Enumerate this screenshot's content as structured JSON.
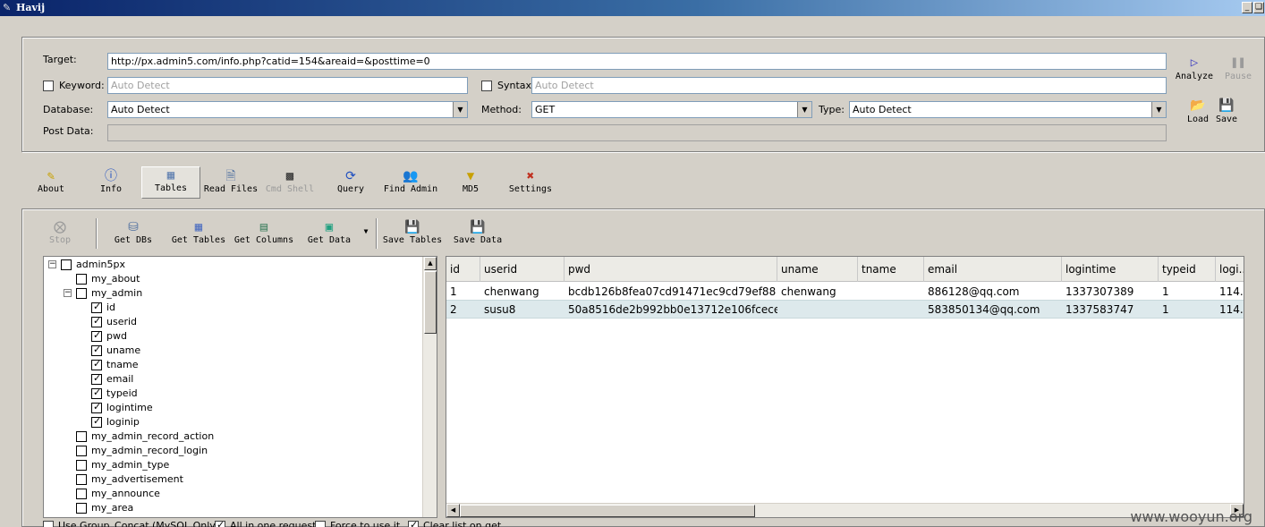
{
  "window": {
    "title": "Havij"
  },
  "form": {
    "target_label": "Target:",
    "target_value": "http://px.admin5.com/info.php?catid=154&areaid=&posttime=0",
    "keyword_label": "Keyword:",
    "keyword_placeholder": "Auto Detect",
    "syntax_label": "Syntax:",
    "syntax_placeholder": "Auto Detect",
    "database_label": "Database:",
    "database_value": "Auto Detect",
    "method_label": "Method:",
    "method_value": "GET",
    "type_label": "Type:",
    "type_value": "Auto Detect",
    "postdata_label": "Post Data:"
  },
  "side": {
    "analyze": "Analyze",
    "pause": "Pause",
    "load": "Load",
    "save": "Save"
  },
  "toolbar": {
    "about": "About",
    "info": "Info",
    "tables": "Tables",
    "read_files": "Read Files",
    "cmd_shell": "Cmd Shell",
    "query": "Query",
    "find_admin": "Find Admin",
    "md5": "MD5",
    "settings": "Settings"
  },
  "subtoolbar": {
    "stop": "Stop",
    "get_dbs": "Get DBs",
    "get_tables": "Get Tables",
    "get_columns": "Get Columns",
    "get_data": "Get Data",
    "save_tables": "Save Tables",
    "save_data": "Save Data"
  },
  "tree": {
    "root": "admin5px",
    "items": [
      {
        "label": "my_about",
        "checked": false
      },
      {
        "label": "my_admin",
        "checked": false,
        "expanded": true
      },
      {
        "label": "id",
        "checked": true,
        "child": true
      },
      {
        "label": "userid",
        "checked": true,
        "child": true
      },
      {
        "label": "pwd",
        "checked": true,
        "child": true
      },
      {
        "label": "uname",
        "checked": true,
        "child": true
      },
      {
        "label": "tname",
        "checked": true,
        "child": true
      },
      {
        "label": "email",
        "checked": true,
        "child": true
      },
      {
        "label": "typeid",
        "checked": true,
        "child": true
      },
      {
        "label": "logintime",
        "checked": true,
        "child": true
      },
      {
        "label": "loginip",
        "checked": true,
        "child": true
      },
      {
        "label": "my_admin_record_action",
        "checked": false
      },
      {
        "label": "my_admin_record_login",
        "checked": false
      },
      {
        "label": "my_admin_type",
        "checked": false
      },
      {
        "label": "my_advertisement",
        "checked": false
      },
      {
        "label": "my_announce",
        "checked": false
      },
      {
        "label": "my_area",
        "checked": false
      }
    ]
  },
  "grid": {
    "columns": [
      "id",
      "userid",
      "pwd",
      "uname",
      "tname",
      "email",
      "logintime",
      "typeid",
      "logi..."
    ],
    "rows": [
      [
        "1",
        "chenwang",
        "bcdb126b8fea07cd91471ec9cd79ef88",
        "chenwang",
        "",
        "886128@qq.com",
        "1337307389",
        "1",
        "114..."
      ],
      [
        "2",
        "susu8",
        "50a8516de2b992bb0e13712e106fcece",
        "",
        "",
        "583850134@qq.com",
        "1337583747",
        "1",
        "114..."
      ]
    ]
  },
  "options": {
    "group_concat": "Use Group_Concat (MySQL Only)",
    "all_in_one": "All in one request",
    "force": "Force to use it",
    "clear_list": "Clear list on get"
  },
  "watermark": "www.wooyun.org",
  "colors": {
    "row_alt": "#dde9ec",
    "title_start": "#0a246a"
  }
}
